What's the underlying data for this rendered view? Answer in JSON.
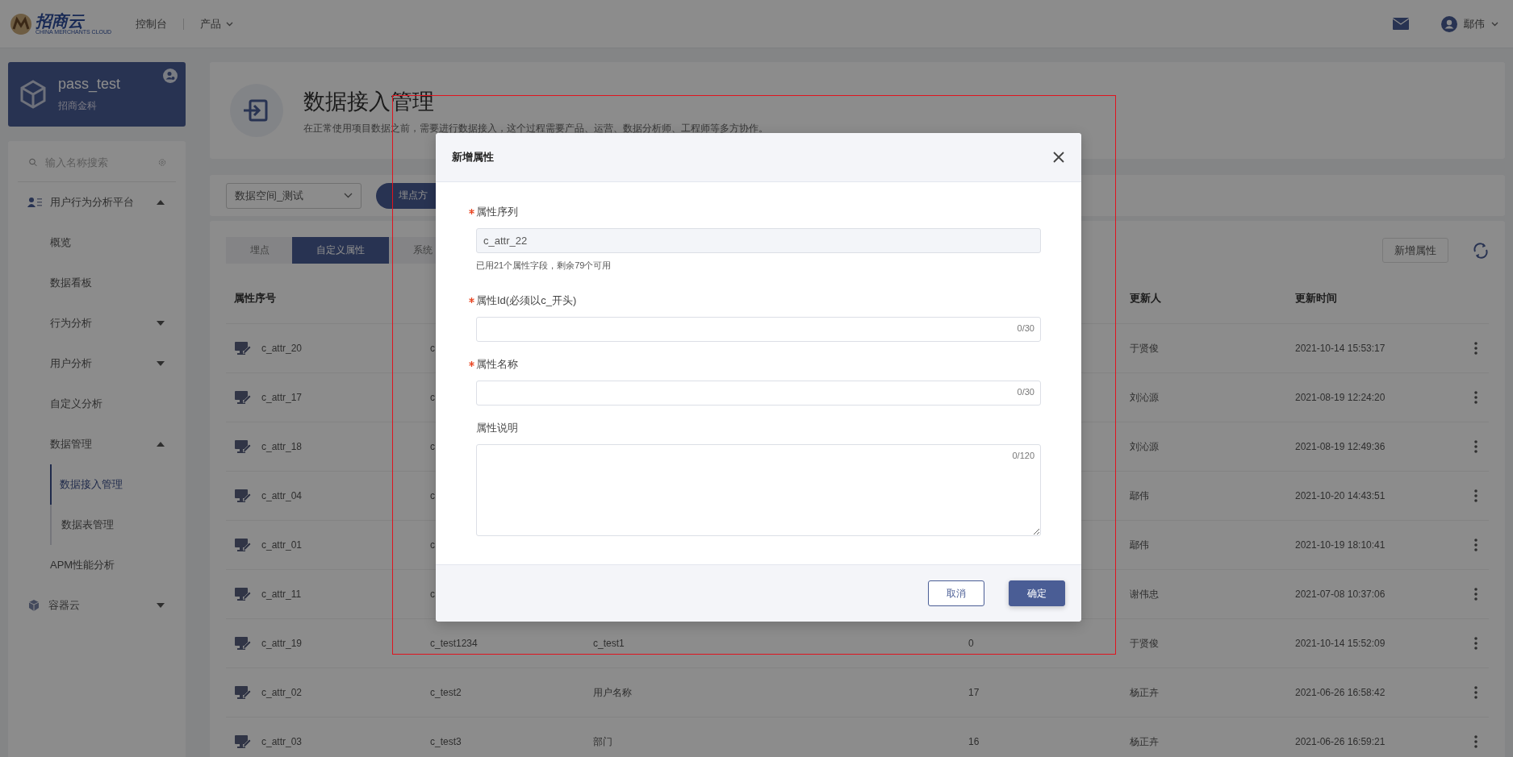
{
  "topbar": {
    "logo_text": "招商云",
    "logo_subtitle": "CHINA MERCHANTS CLOUD",
    "nav": [
      {
        "label": "控制台",
        "dropdown": false
      },
      {
        "label": "产品",
        "dropdown": true
      }
    ],
    "user": "鄢伟"
  },
  "sidebar": {
    "project": {
      "name": "pass_test",
      "org": "招商金科"
    },
    "search": {
      "placeholder": "输入名称搜索"
    },
    "items": [
      {
        "label": "用户行为分析平台",
        "expanded": true,
        "selected": false,
        "children": [
          {
            "label": "概览",
            "selected": false
          },
          {
            "label": "数据看板",
            "selected": false
          },
          {
            "label": "行为分析",
            "expanded": false,
            "selected": false
          },
          {
            "label": "用户分析",
            "expanded": false,
            "selected": false
          },
          {
            "label": "自定义分析",
            "selected": false
          },
          {
            "label": "数据管理",
            "expanded": true,
            "selected": false,
            "children": [
              {
                "label": "数据接入管理",
                "selected": true
              },
              {
                "label": "数据表管理",
                "selected": false
              }
            ]
          },
          {
            "label": "APM性能分析",
            "selected": false
          }
        ]
      },
      {
        "label": "容器云",
        "expanded": false,
        "selected": false
      }
    ]
  },
  "page_header": {
    "title": "数据接入管理",
    "description": "在正常使用项目数据之前，需要进行数据接入，这个过程需要产品、运营、数据分析师、工程师等多方协作。"
  },
  "filter": {
    "space_select": "数据空间_测试",
    "button": "埋点方"
  },
  "tabs": [
    {
      "label": "埋点",
      "selected": false
    },
    {
      "label": "自定义属性",
      "selected": true
    },
    {
      "label": "系统",
      "selected": false
    }
  ],
  "toolbar": {
    "add_button": "新增属性"
  },
  "table": {
    "columns": {
      "column_1": "属性序号",
      "column_5": "更新人",
      "column_6": "更新时间"
    },
    "rows": [
      {
        "column_1": "c_attr_20",
        "column_2": "c",
        "column_5": "于贤俊",
        "column_6": "2021-10-14 15:53:17"
      },
      {
        "column_1": "c_attr_17",
        "column_2": "c",
        "column_5": "刘沁源",
        "column_6": "2021-08-19 12:24:20"
      },
      {
        "column_1": "c_attr_18",
        "column_2": "c",
        "column_5": "刘沁源",
        "column_6": "2021-08-19 12:49:36"
      },
      {
        "column_1": "c_attr_04",
        "column_2": "c",
        "column_5": "鄢伟",
        "column_6": "2021-10-20 14:43:51"
      },
      {
        "column_1": "c_attr_01",
        "column_2": "c",
        "column_5": "鄢伟",
        "column_6": "2021-10-19 18:10:41"
      },
      {
        "column_1": "c_attr_11",
        "column_2": "c",
        "column_5": "谢伟忠",
        "column_6": "2021-07-08 10:37:06"
      },
      {
        "column_1": "c_attr_19",
        "column_2": "c_test1234",
        "column_3": "c_test1",
        "column_4": "0",
        "column_5": "于贤俊",
        "column_6": "2021-10-14 15:52:09"
      },
      {
        "column_1": "c_attr_02",
        "column_2": "c_test2",
        "column_3": "用户名称",
        "column_4": "17",
        "column_5": "杨正卉",
        "column_6": "2021-06-26 16:58:42"
      },
      {
        "column_1": "c_attr_03",
        "column_2": "c_test3",
        "column_3": "部门",
        "column_4": "16",
        "column_5": "杨正卉",
        "column_6": "2021-06-26 16:59:21"
      }
    ]
  },
  "modal": {
    "title": "新增属性",
    "fields": [
      {
        "kind": "input",
        "label": "属性序列",
        "required": true,
        "value": "c_attr_22",
        "disabled": true,
        "hint": "已用21个属性字段，剩余79个可用"
      },
      {
        "kind": "input",
        "label": "属性Id(必须以c_开头)",
        "required": true,
        "disabled": false,
        "counter": "0/30"
      },
      {
        "kind": "input",
        "label": "属性名称",
        "required": true,
        "disabled": false,
        "counter": "0/30"
      },
      {
        "kind": "textarea",
        "label": "属性说明",
        "required": false,
        "counter": "0/120"
      }
    ],
    "buttons": [
      {
        "label": "取消",
        "kind": "secondary"
      },
      {
        "label": "确定",
        "kind": "primary"
      }
    ]
  },
  "highlight_frame": true
}
